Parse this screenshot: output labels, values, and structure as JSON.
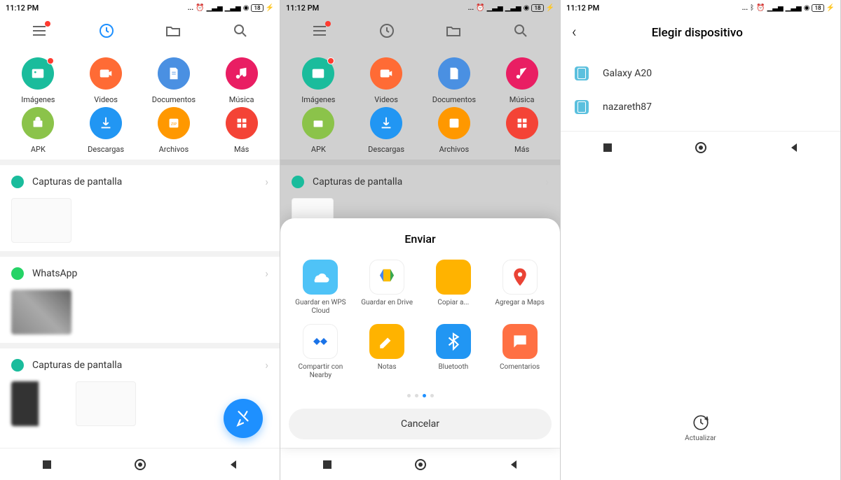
{
  "statusbar": {
    "time": "11:12 PM",
    "battery": "18",
    "indicators": "... ⏰ ⁴ᴳ 📶 📶 📶"
  },
  "categories": [
    {
      "label": "Imágenes",
      "color": "#1abc9c",
      "dot": true
    },
    {
      "label": "Videos",
      "color": "#ff6b35",
      "dot": false
    },
    {
      "label": "Documentos",
      "color": "#4a90e2",
      "dot": false
    },
    {
      "label": "Música",
      "color": "#e91e63",
      "dot": false
    },
    {
      "label": "APK",
      "color": "#8bc34a",
      "dot": false
    },
    {
      "label": "Descargas",
      "color": "#2196f3",
      "dot": false
    },
    {
      "label": "Archivos",
      "color": "#ff9800",
      "dot": false
    },
    {
      "label": "Más",
      "color": "#f44336",
      "dot": false
    }
  ],
  "sections": [
    {
      "title": "Capturas de pantalla"
    },
    {
      "title": "WhatsApp"
    },
    {
      "title": "Capturas de pantalla"
    }
  ],
  "share": {
    "title": "Enviar",
    "cancel": "Cancelar",
    "options": [
      {
        "label": "Guardar en WPS Cloud",
        "color": "#4fc3f7"
      },
      {
        "label": "Guardar en Drive",
        "color": "#fff"
      },
      {
        "label": "Copiar a...",
        "color": "#ffb300"
      },
      {
        "label": "Agregar a Maps",
        "color": "#fff"
      },
      {
        "label": "Compartir con Nearby",
        "color": "#fff"
      },
      {
        "label": "Notas",
        "color": "#ffb300"
      },
      {
        "label": "Bluetooth",
        "color": "#2196f3"
      },
      {
        "label": "Comentarios",
        "color": "#ff7043"
      }
    ]
  },
  "devicePicker": {
    "title": "Elegir dispositivo",
    "refresh": "Actualizar",
    "devices": [
      {
        "name": "Galaxy A20"
      },
      {
        "name": "nazareth87"
      }
    ]
  }
}
